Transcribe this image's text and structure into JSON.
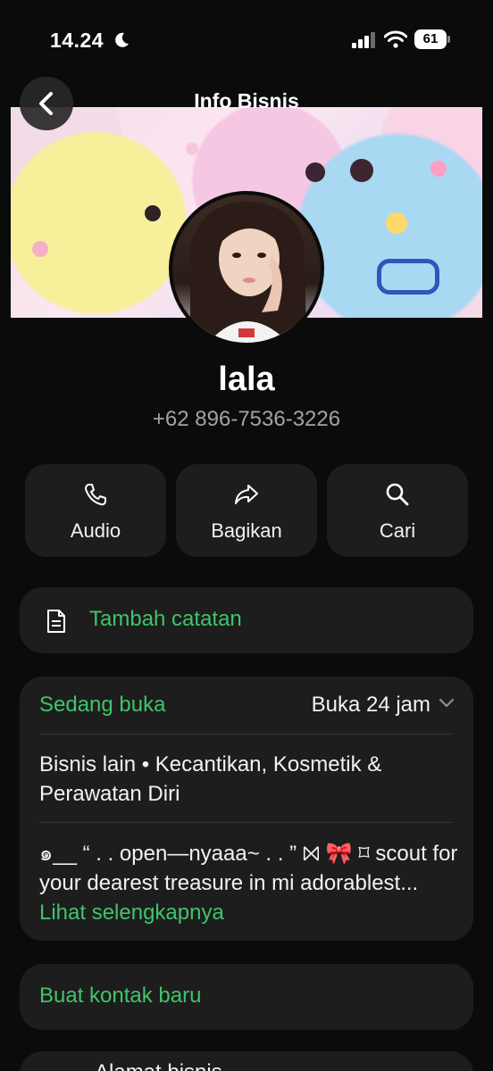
{
  "status_bar": {
    "time": "14.24",
    "battery_level": "61",
    "icons": [
      "moon-icon",
      "signal-icon",
      "wifi-icon",
      "battery-icon"
    ]
  },
  "header": {
    "title": "Info Bisnis",
    "back_icon": "chevron-left-icon"
  },
  "profile": {
    "name": "lala",
    "phone": "+62 896-7536-3226"
  },
  "actions": [
    {
      "label": "Audio",
      "icon": "phone-icon"
    },
    {
      "label": "Bagikan",
      "icon": "share-icon"
    },
    {
      "label": "Cari",
      "icon": "search-icon"
    }
  ],
  "note": {
    "label": "Tambah catatan",
    "icon": "document-icon"
  },
  "business_info": {
    "open_status": "Sedang buka",
    "hours": "Buka 24 jam",
    "category": "Bisnis lain • Kecantikan, Kosmetik & Perawatan Diri",
    "description": "๑__ “ . . open—nyaaa~ . . ” ⨝ 🎀 ⌑ scout for your dearest treasure in mi adorablest...",
    "see_more": "Lihat selengkapnya"
  },
  "contact": {
    "label": "Buat kontak baru"
  },
  "next_section": {
    "label": "Alamat bisnis"
  },
  "colors": {
    "background": "#0b0b0b",
    "card": "#1d1d1d",
    "accent_green": "#3fc46a",
    "secondary_text": "#a3a3a3"
  }
}
